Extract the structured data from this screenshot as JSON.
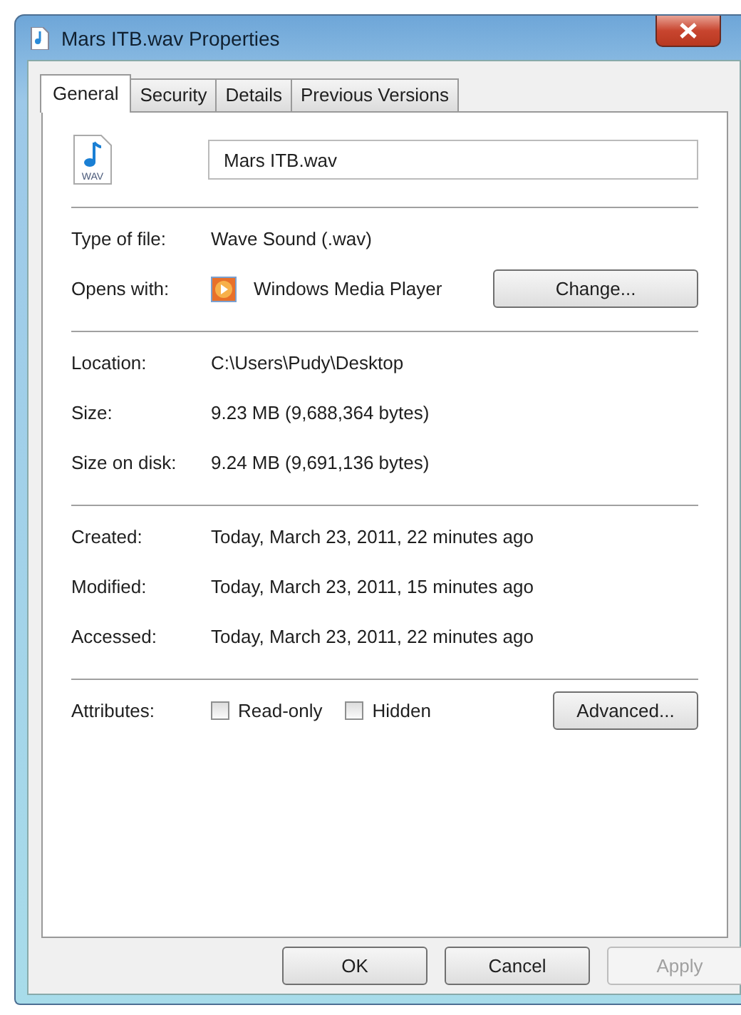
{
  "window": {
    "title": "Mars ITB.wav Properties"
  },
  "tabs": [
    {
      "label": "General",
      "selected": true
    },
    {
      "label": "Security",
      "selected": false
    },
    {
      "label": "Details",
      "selected": false
    },
    {
      "label": "Previous Versions",
      "selected": false
    }
  ],
  "file_name": {
    "value": "Mars ITB.wav",
    "icon_label": "WAV"
  },
  "sections": [
    {
      "rows": [
        {
          "kind": "text",
          "label": "Type of file:",
          "value": "Wave Sound (.wav)"
        },
        {
          "kind": "app",
          "label": "Opens with:",
          "value": "Windows Media Player",
          "button": "Change..."
        }
      ]
    },
    {
      "rows": [
        {
          "kind": "text",
          "label": "Location:",
          "value": "C:\\Users\\Pudy\\Desktop"
        },
        {
          "kind": "text",
          "label": "Size:",
          "value": "9.23 MB (9,688,364 bytes)"
        },
        {
          "kind": "text",
          "label": "Size on disk:",
          "value": "9.24 MB (9,691,136 bytes)"
        }
      ]
    },
    {
      "rows": [
        {
          "kind": "text",
          "label": "Created:",
          "value": "Today, March 23, 2011, 22 minutes ago"
        },
        {
          "kind": "text",
          "label": "Modified:",
          "value": "Today, March 23, 2011, 15 minutes ago"
        },
        {
          "kind": "text",
          "label": "Accessed:",
          "value": "Today, March 23, 2011, 22 minutes ago"
        }
      ]
    }
  ],
  "attributes": {
    "label": "Attributes:",
    "checkboxes": [
      {
        "label": "Read-only",
        "checked": false
      },
      {
        "label": "Hidden",
        "checked": false
      }
    ],
    "button": "Advanced..."
  },
  "buttons": [
    {
      "label": "OK",
      "disabled": false
    },
    {
      "label": "Cancel",
      "disabled": false
    },
    {
      "label": "Apply",
      "disabled": true
    }
  ]
}
